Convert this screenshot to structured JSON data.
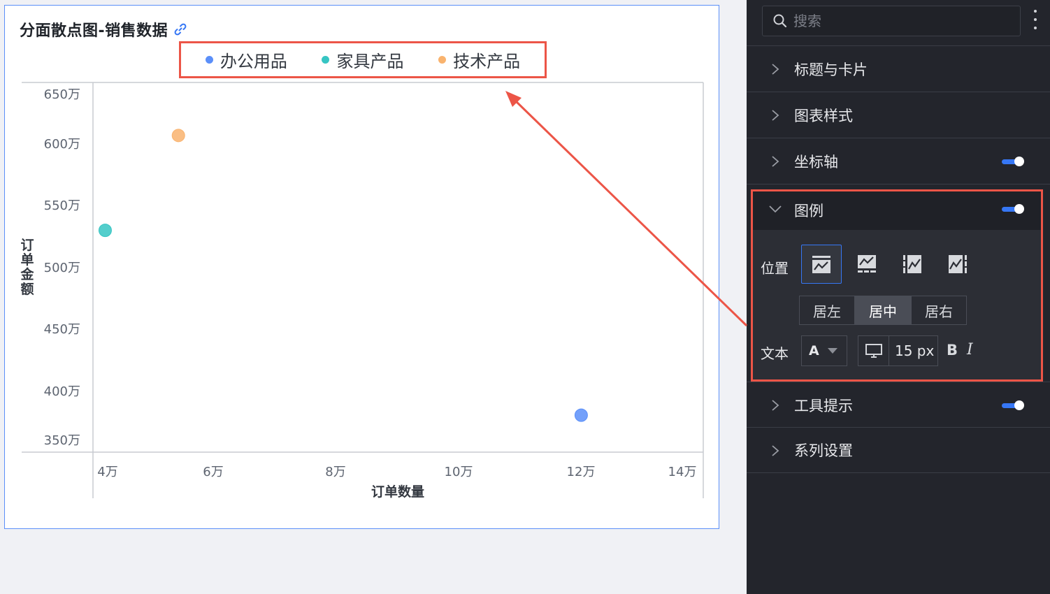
{
  "chart": {
    "title": "分面散点图-销售数据",
    "legend": [
      {
        "label": "办公用品",
        "color": "#5b8ff9"
      },
      {
        "label": "家具产品",
        "color": "#36c5c3"
      },
      {
        "label": "技术产品",
        "color": "#f9b36e"
      }
    ]
  },
  "chart_data": {
    "type": "scatter",
    "title": "分面散点图-销售数据",
    "xlabel": "订单数量",
    "ylabel": "订单金额",
    "x_ticks": [
      "4万",
      "6万",
      "8万",
      "10万",
      "12万",
      "14万"
    ],
    "y_ticks": [
      "650万",
      "600万",
      "550万",
      "500万",
      "450万",
      "400万",
      "350万"
    ],
    "xlim": [
      40000,
      140000
    ],
    "ylim": [
      3500000,
      6500000
    ],
    "series": [
      {
        "name": "办公用品",
        "color": "#5b8ff9",
        "points": [
          {
            "x": 120000,
            "y": 3800000
          }
        ]
      },
      {
        "name": "家具产品",
        "color": "#36c5c3",
        "points": [
          {
            "x": 42000,
            "y": 5300000
          }
        ]
      },
      {
        "name": "技术产品",
        "color": "#f9b36e",
        "points": [
          {
            "x": 54000,
            "y": 6070000
          }
        ]
      }
    ]
  },
  "panel": {
    "search_placeholder": "搜索",
    "sections": [
      {
        "label": "标题与卡片",
        "expanded": false,
        "toggle": false
      },
      {
        "label": "图表样式",
        "expanded": false,
        "toggle": false
      },
      {
        "label": "坐标轴",
        "expanded": false,
        "toggle": true
      },
      {
        "label": "图例",
        "expanded": true,
        "toggle": true
      },
      {
        "label": "工具提示",
        "expanded": false,
        "toggle": true
      },
      {
        "label": "系列设置",
        "expanded": false,
        "toggle": false
      }
    ],
    "legend_settings": {
      "position_label": "位置",
      "align_options": [
        "居左",
        "居中",
        "居右"
      ],
      "align_selected": "居中",
      "text_label": "文本",
      "font_color_glyph": "A",
      "font_size": "15 px",
      "bold_glyph": "B",
      "italic_glyph": "I"
    }
  },
  "colors": {
    "accent": "#3677f5",
    "highlight": "#ec5547"
  }
}
